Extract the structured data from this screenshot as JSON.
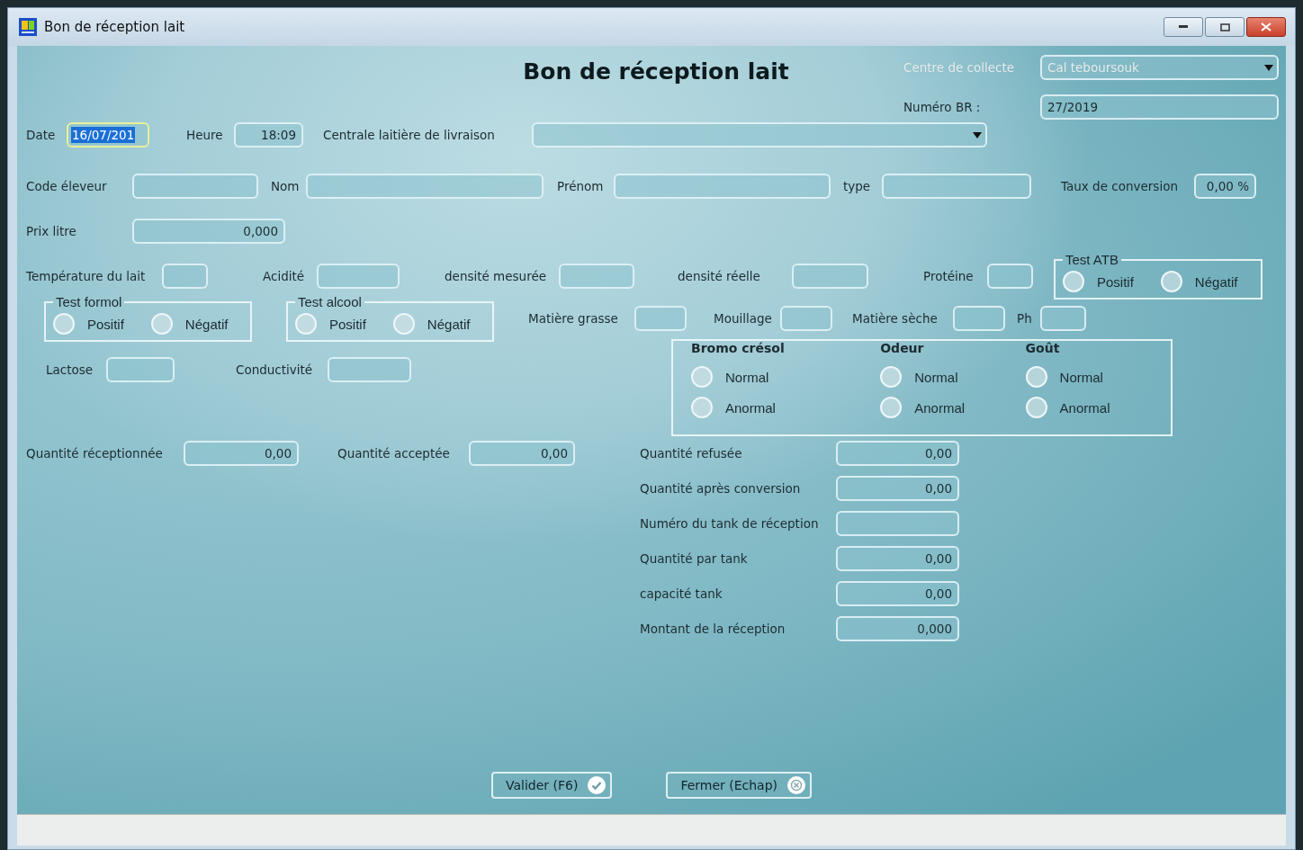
{
  "window": {
    "title": "Bon de réception lait"
  },
  "form_title": "Bon de réception lait",
  "centre_collecte": {
    "label": "Centre de collecte",
    "value": "Cal teboursouk",
    "disabled": true
  },
  "numero_br": {
    "label": "Numéro BR :",
    "value": "27/2019"
  },
  "date": {
    "label": "Date",
    "value": "16/07/201",
    "text_selected": true
  },
  "heure": {
    "label": "Heure",
    "value": "18:09"
  },
  "centrale": {
    "label": "Centrale laitière de livraison"
  },
  "row_eleveur": [
    {
      "label": "Code éleveur"
    },
    {
      "label": "Nom"
    },
    {
      "label": "Prénom"
    },
    {
      "label": "type"
    },
    {
      "label": "Taux de conversion",
      "value": "0,00 %"
    }
  ],
  "prix_litre": {
    "label": "Prix litre",
    "value": "0,000"
  },
  "row_mesures": [
    {
      "label": "Température du lait"
    },
    {
      "label": "Acidité"
    },
    {
      "label": "densité mesurée"
    },
    {
      "label": "densité réelle"
    },
    {
      "label": "Protéine"
    }
  ],
  "test_atb": {
    "title": "Test ATB",
    "options": [
      {
        "label": "Positif",
        "selected": false
      },
      {
        "label": "Négatif",
        "selected": false
      }
    ]
  },
  "test_formol": {
    "title": "Test formol",
    "options": [
      {
        "label": "Positif",
        "selected": false
      },
      {
        "label": "Négatif",
        "selected": false
      }
    ]
  },
  "test_alcool": {
    "title": "Test alcool",
    "options": [
      {
        "label": "Positif",
        "selected": false
      },
      {
        "label": "Négatif",
        "selected": false
      }
    ]
  },
  "row_composition": [
    {
      "label": "Matière grasse"
    },
    {
      "label": "Mouillage"
    },
    {
      "label": "Matière sèche"
    },
    {
      "label": "Ph"
    }
  ],
  "row_lactose": [
    {
      "label": "Lactose"
    },
    {
      "label": "Conductivité"
    }
  ],
  "aspects": [
    {
      "title": "Bromo crésol",
      "options": [
        {
          "label": "Normal",
          "selected": false
        },
        {
          "label": "Anormal",
          "selected": false
        }
      ]
    },
    {
      "title": "Odeur",
      "options": [
        {
          "label": "Normal",
          "selected": false
        },
        {
          "label": "Anormal",
          "selected": false
        }
      ]
    },
    {
      "title": "Goût",
      "options": [
        {
          "label": "Normal",
          "selected": false
        },
        {
          "label": "Anormal",
          "selected": false
        }
      ]
    }
  ],
  "quantites_gauche": [
    {
      "label": "Quantité réceptionnée",
      "value": "0,00"
    },
    {
      "label": "Quantité acceptée",
      "value": "0,00"
    }
  ],
  "quantites_droite": [
    {
      "label": "Quantité refusée",
      "value": "0,00"
    },
    {
      "label": "Quantité après conversion",
      "value": "0,00"
    },
    {
      "label": "Numéro du tank de réception"
    },
    {
      "label": "Quantité par tank",
      "value": "0,00"
    },
    {
      "label": "capacité tank",
      "value": "0,00"
    },
    {
      "label": "Montant de la réception",
      "value": "0,000"
    }
  ],
  "buttons": [
    {
      "label": "Valider (F6)",
      "kind": "validate"
    },
    {
      "label": "Fermer (Echap)",
      "kind": "close"
    }
  ]
}
